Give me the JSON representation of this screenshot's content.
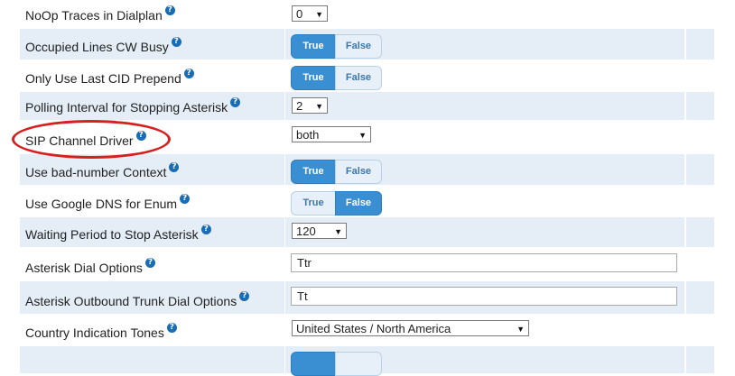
{
  "help_glyph": "?",
  "rows": [
    {
      "label": "NoOp Traces in Dialplan",
      "control": "select",
      "value": "0"
    },
    {
      "label": "Occupied Lines CW Busy",
      "control": "toggle",
      "true_label": "True",
      "false_label": "False",
      "selected": "True"
    },
    {
      "label": "Only Use Last CID Prepend",
      "control": "toggle",
      "true_label": "True",
      "false_label": "False",
      "selected": "True"
    },
    {
      "label": "Polling Interval for Stopping Asterisk",
      "control": "select",
      "value": "2"
    },
    {
      "label": "SIP Channel Driver",
      "control": "select",
      "value": "both",
      "highlighted": true
    },
    {
      "label": "Use bad-number Context",
      "control": "toggle",
      "true_label": "True",
      "false_label": "False",
      "selected": "True"
    },
    {
      "label": "Use Google DNS for Enum",
      "control": "toggle",
      "true_label": "True",
      "false_label": "False",
      "selected": "False"
    },
    {
      "label": "Waiting Period to Stop Asterisk",
      "control": "select",
      "value": "120"
    },
    {
      "label": "Asterisk Dial Options",
      "control": "text",
      "value": "Ttr"
    },
    {
      "label": "Asterisk Outbound Trunk Dial Options",
      "control": "text",
      "value": "Tt"
    },
    {
      "label": "Country Indication Tones",
      "control": "select",
      "value": "United States / North America"
    },
    {
      "label": "",
      "control": "toggle",
      "true_label": "",
      "false_label": "",
      "selected": "True"
    }
  ],
  "colors": {
    "row_alt": "#e5eef7",
    "toggle_on": "#3a8fd2",
    "toggle_off": "#e7f0f9",
    "help_icon": "#1a6cb5",
    "annotation": "#d62020"
  }
}
